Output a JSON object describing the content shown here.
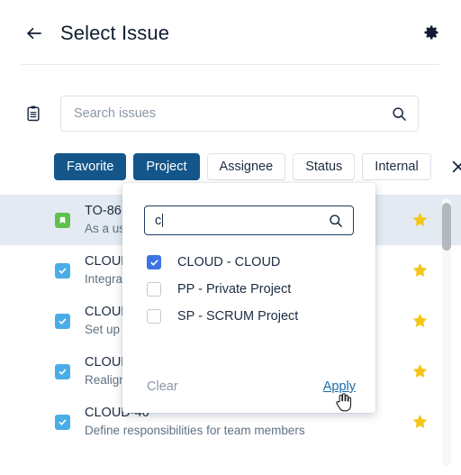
{
  "header": {
    "back_icon": "arrow-left-icon",
    "title": "Select Issue",
    "settings_icon": "gear-icon"
  },
  "search": {
    "leading_icon": "clipboard-icon",
    "placeholder": "Search issues",
    "value": "",
    "search_icon": "search-icon"
  },
  "filters": {
    "chips": [
      {
        "label": "Favorite",
        "active": true
      },
      {
        "label": "Project",
        "active": true
      },
      {
        "label": "Assignee",
        "active": false
      },
      {
        "label": "Status",
        "active": false
      },
      {
        "label": "Internal",
        "active": false
      }
    ],
    "close_icon": "close-icon"
  },
  "project_dropdown": {
    "search_value": "c",
    "search_icon": "search-icon",
    "options": [
      {
        "label": "CLOUD - CLOUD",
        "checked": true
      },
      {
        "label": "PP - Private Project",
        "checked": false
      },
      {
        "label": "SP - SCRUM Project",
        "checked": false
      }
    ],
    "clear_label": "Clear",
    "apply_label": "Apply",
    "apply_hovered": true
  },
  "issues": [
    {
      "key": "TO-86",
      "summary": "As a us",
      "type_icon": "story-icon",
      "type_color": "#5fc04e",
      "selected": true,
      "starred": true
    },
    {
      "key": "CLOUD",
      "summary": "Integra",
      "type_icon": "task-icon",
      "type_color": "#4bade8",
      "selected": false,
      "starred": true
    },
    {
      "key": "CLOUD",
      "summary": "Set up",
      "type_icon": "task-icon",
      "type_color": "#4bade8",
      "selected": false,
      "starred": true
    },
    {
      "key": "CLOUD",
      "summary": "Realign",
      "type_icon": "task-icon",
      "type_color": "#4bade8",
      "selected": false,
      "starred": true
    },
    {
      "key": "CLOUD-46",
      "summary": "Define responsibilities for team members",
      "type_icon": "task-icon",
      "type_color": "#4bade8",
      "selected": false,
      "starred": true
    }
  ],
  "colors": {
    "chip_active": "#14568a",
    "selected_row": "#e3eaf1",
    "star": "#f5c518",
    "checkbox_checked": "#3d74e3",
    "apply_link": "#1a6aa8"
  },
  "scrollbar": {
    "present": true
  }
}
